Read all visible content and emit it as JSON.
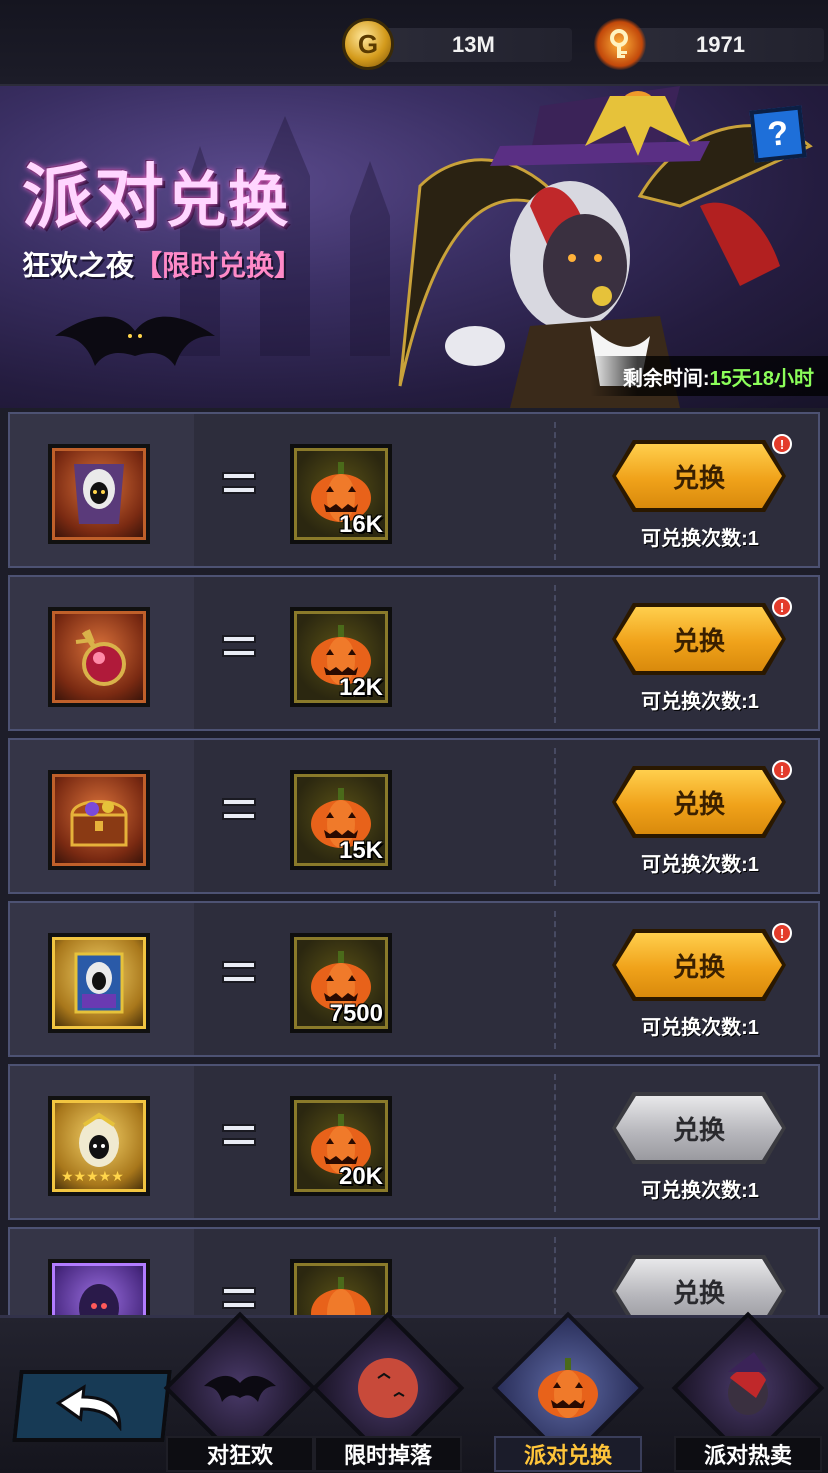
{
  "resources": {
    "gold": {
      "icon": "gold-coin-icon",
      "value": "13M"
    },
    "keys": {
      "icon": "flame-key-icon",
      "value": "1971"
    }
  },
  "banner": {
    "title_part1": "派对",
    "title_part2": "兑换",
    "subtitle": "狂欢之夜",
    "subtitle_tag": "【限时兑换】",
    "help_label": "?",
    "timer_label": "剩余时间:",
    "timer_value": "15天18小时"
  },
  "exchange": {
    "button_label": "兑换",
    "remaining_label": "可兑换次数:",
    "items": [
      {
        "reward": "hooded-hero-card",
        "cost": "16K",
        "remaining": "1",
        "enabled": true,
        "alert": "!"
      },
      {
        "reward": "ruby-mace",
        "cost": "12K",
        "remaining": "1",
        "enabled": true,
        "alert": "!"
      },
      {
        "reward": "treasure-chest",
        "cost": "15K",
        "remaining": "1",
        "enabled": true,
        "alert": "!"
      },
      {
        "reward": "hero-portrait-card",
        "cost": "7500",
        "remaining": "1",
        "enabled": true,
        "alert": "!"
      },
      {
        "reward": "five-star-hero",
        "cost": "20K",
        "remaining": "1",
        "enabled": false,
        "stars": "★★★★★"
      },
      {
        "reward": "purple-hero",
        "cost": "",
        "remaining": "",
        "enabled": false
      }
    ]
  },
  "bottom_nav": {
    "back_icon": "back-arrow-icon",
    "tabs": [
      {
        "label": "对狂欢",
        "icon": "bat-icon",
        "active": false
      },
      {
        "label": "限时掉落",
        "icon": "moon-bats-icon",
        "active": false
      },
      {
        "label": "派对兑换",
        "icon": "pumpkin-icon",
        "active": true
      },
      {
        "label": "派对热卖",
        "icon": "witch-hero-icon",
        "active": false
      }
    ]
  },
  "colors": {
    "accent_gold": "#f0a21a",
    "timer_green": "#8cff5a",
    "title_pink": "#ffd6ff",
    "active_tab": "#ffc53a",
    "alert_red": "#e33b2b"
  }
}
